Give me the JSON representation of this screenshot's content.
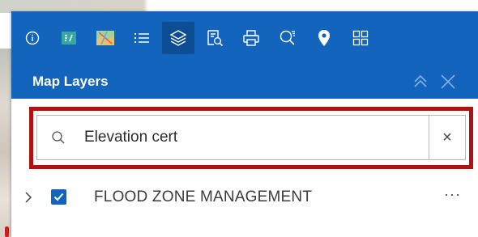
{
  "toolbar": {
    "tools": [
      {
        "icon": "info-icon",
        "active": false
      },
      {
        "icon": "legend-icon",
        "active": false
      },
      {
        "icon": "basemap-icon",
        "active": false
      },
      {
        "icon": "list-icon",
        "active": false
      },
      {
        "icon": "layers-icon",
        "active": true
      },
      {
        "icon": "query-icon",
        "active": false
      },
      {
        "icon": "print-icon",
        "active": false
      },
      {
        "icon": "search-icon",
        "active": false
      },
      {
        "icon": "location-pin-icon",
        "active": false
      },
      {
        "icon": "grid-icon",
        "active": false
      }
    ]
  },
  "panel": {
    "title": "Map Layers",
    "header_actions": [
      "collapse-icon",
      "close-icon"
    ]
  },
  "search": {
    "value": "Elevation cert",
    "clear_symbol": "×"
  },
  "layers": [
    {
      "name": "FLOOD ZONE MANAGEMENT",
      "checked": true,
      "more": "···"
    }
  ],
  "colors": {
    "accent": "#1264bd",
    "active_tool": "#0c4d93",
    "highlight": "#b21113"
  }
}
